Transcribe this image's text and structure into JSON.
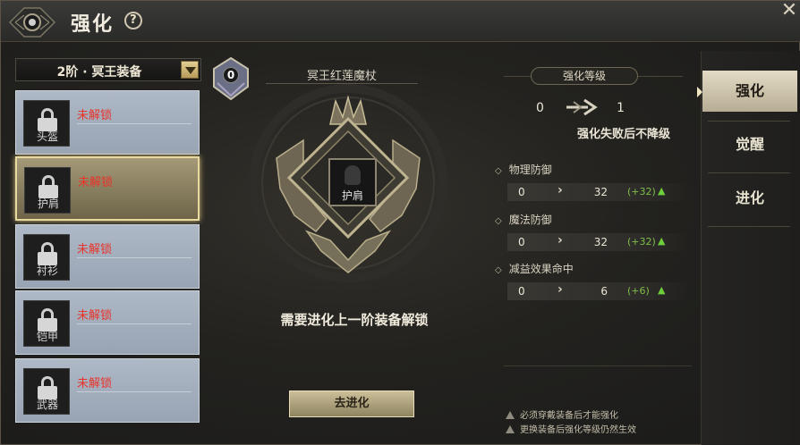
{
  "window": {
    "title": "强化",
    "help_label": "?",
    "close_label": "✕"
  },
  "tier_selector": {
    "value": "2阶 · 冥王装备"
  },
  "slots": [
    {
      "name": "头盔",
      "status": "未解锁",
      "selected": false
    },
    {
      "name": "护肩",
      "status": "未解锁",
      "selected": true
    },
    {
      "name": "衬衫",
      "status": "未解锁",
      "selected": false
    },
    {
      "name": "铠甲",
      "status": "未解锁",
      "selected": false
    },
    {
      "name": "武器",
      "status": "未解锁",
      "selected": false
    }
  ],
  "center": {
    "level_badge": "0",
    "item_name": "冥王红莲魔杖",
    "slot_name": "护肩",
    "unlock_message": "需要进化上一阶装备解锁",
    "evolve_button": "去进化"
  },
  "enhance": {
    "header": "强化等级",
    "level_from": "0",
    "level_to": "1",
    "note": "强化失败后不降级",
    "stats": [
      {
        "name": "物理防御",
        "from": "0",
        "to": "32",
        "delta": "(+32)"
      },
      {
        "name": "魔法防御",
        "from": "0",
        "to": "32",
        "delta": "(+32)"
      },
      {
        "name": "减益效果命中",
        "from": "0",
        "to": "6",
        "delta": "(+6)"
      }
    ],
    "footnotes": [
      "必须穿戴装备后才能强化",
      "更换装备后强化等级仍然生效"
    ]
  },
  "tabs": [
    {
      "label": "强化",
      "active": true
    },
    {
      "label": "觉醒",
      "active": false
    },
    {
      "label": "进化",
      "active": false
    }
  ],
  "colors": {
    "locked_text": "#e8332a",
    "gain_text": "#7fbf4a",
    "accent_gold": "#e9d9a0"
  }
}
